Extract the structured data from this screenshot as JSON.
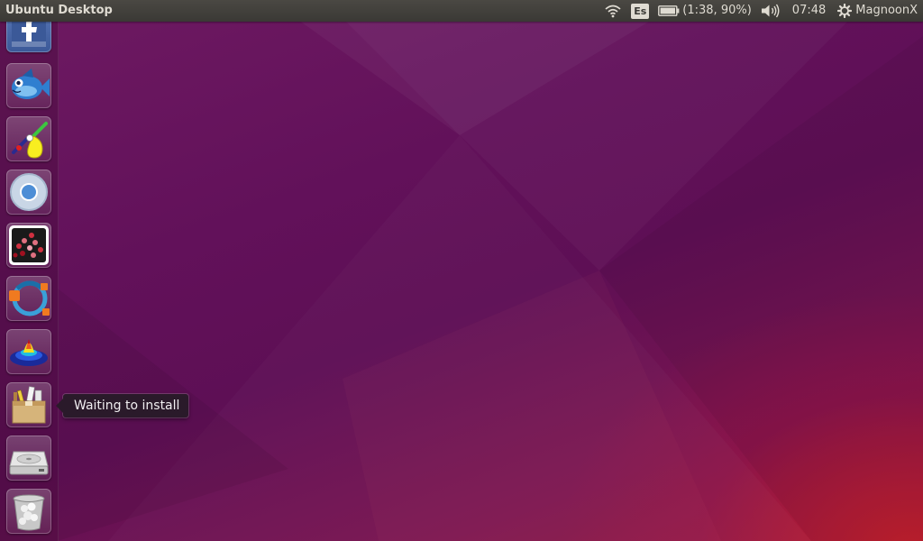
{
  "panel": {
    "title": "Ubuntu Desktop",
    "keyboard_layout": "Es",
    "battery_text": "(1:38, 90%)",
    "clock": "07:48",
    "user": "MagnoonX"
  },
  "launcher": {
    "items": [
      {
        "name": "facebook",
        "icon": "facebook-icon"
      },
      {
        "name": "bluefish-editor",
        "icon": "fish-icon"
      },
      {
        "name": "paint-tool",
        "icon": "paint-brush-icon"
      },
      {
        "name": "chromium-browser",
        "icon": "chromium-icon"
      },
      {
        "name": "dots-app",
        "icon": "dots-grid-icon"
      },
      {
        "name": "vector-editor",
        "icon": "bezier-circle-icon"
      },
      {
        "name": "3d-plot-app",
        "icon": "surface-plot-icon"
      },
      {
        "name": "installing-app",
        "icon": "package-icon"
      },
      {
        "name": "disk-drive",
        "icon": "hard-drive-icon"
      },
      {
        "name": "trash",
        "icon": "trash-icon"
      }
    ]
  },
  "tooltip": {
    "text": "Waiting to install"
  },
  "colors": {
    "panel": "#3a3935",
    "wallpaper_purple": "#5e0f55",
    "wallpaper_red": "#c4202c"
  }
}
